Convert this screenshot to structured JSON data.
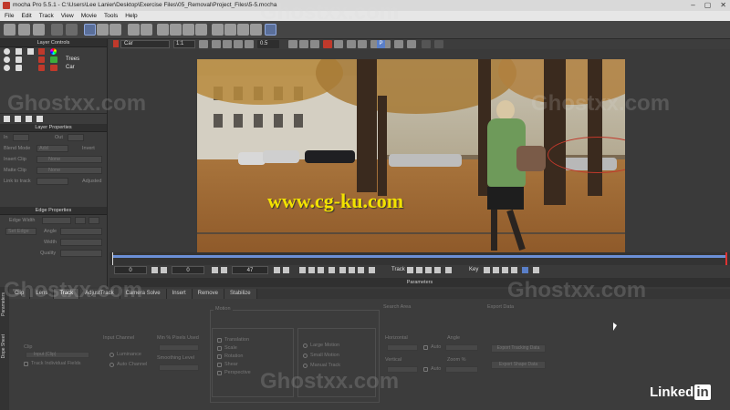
{
  "window": {
    "title": "mocha Pro 5.5.1 - C:\\Users\\Lee Lanier\\Desktop\\Exercise Files\\05_Removal\\Project_Files\\5-5.mocha",
    "controls": [
      "–",
      "▢",
      "✕"
    ]
  },
  "menu": [
    "File",
    "Edit",
    "Track",
    "View",
    "Movie",
    "Tools",
    "Help"
  ],
  "subtoolbar": {
    "layer_select": "Car",
    "zoom": "1:1",
    "opacity": "0.5",
    "channel": "P"
  },
  "layer_controls": {
    "title": "Layer Controls",
    "layers": [
      {
        "name": "Trees",
        "color": "#3cae3c"
      },
      {
        "name": "Car",
        "color": "#c0392b"
      }
    ]
  },
  "layer_properties": {
    "title": "Layer Properties",
    "in_label": "In",
    "out_label": "Out",
    "blend_mode": "Blend Mode",
    "blend_value": "Add",
    "invert": "Invert",
    "insert_clip": "Insert Clip",
    "insert_clip_value": "None",
    "matte_clip": "Matte Clip",
    "matte_clip_value": "None",
    "link_to_track": "Link to track",
    "adjusted": "Adjusted"
  },
  "edge_properties": {
    "title": "Edge Properties",
    "edge_width": "Edge Width",
    "set_edge": "Set Edge",
    "angle": "Angle",
    "width": "Width",
    "quality": "Quality"
  },
  "viewer": {
    "watermark_text": "www.cg-ku.com"
  },
  "transport": {
    "start_frame": "0",
    "in_frame": "0",
    "current_frame": "47",
    "track_label": "Track",
    "key_label": "Key"
  },
  "parameters": {
    "title": "Parameters",
    "tabs": [
      "Clip",
      "Lens",
      "Track",
      "AdjustTrack",
      "Camera Solve",
      "Insert",
      "Remove",
      "Stabilize"
    ],
    "active_tab": "Track",
    "side_tabs": [
      "Parameters",
      "Dope Sheet"
    ],
    "clip_label": "Clip",
    "clip_value": "Input (Clip)",
    "track_individual": "Track Individual Fields",
    "input_channel": "Input Channel",
    "luminance": "Luminance",
    "auto_channel": "Auto Channel",
    "min_pixels": "Min % Pixels Used",
    "smoothing_level": "Smoothing Level",
    "motion": "Motion",
    "translation": "Translation",
    "scale": "Scale",
    "rotation": "Rotation",
    "shear": "Shear",
    "perspective": "Perspective",
    "large_motion": "Large Motion",
    "small_motion": "Small Motion",
    "manual_track": "Manual Track",
    "search_area": "Search Area",
    "horizontal": "Horizontal",
    "vertical": "Vertical",
    "auto": "Auto",
    "angle": "Angle",
    "zoom_pct": "Zoom %",
    "export_data": "Export Data",
    "export_tracking": "Export Tracking Data",
    "export_shape": "Export Shape Data"
  },
  "overlay": {
    "site_watermark": "Ghostxx.com",
    "brand": "Linked",
    "brand_in": "in"
  }
}
